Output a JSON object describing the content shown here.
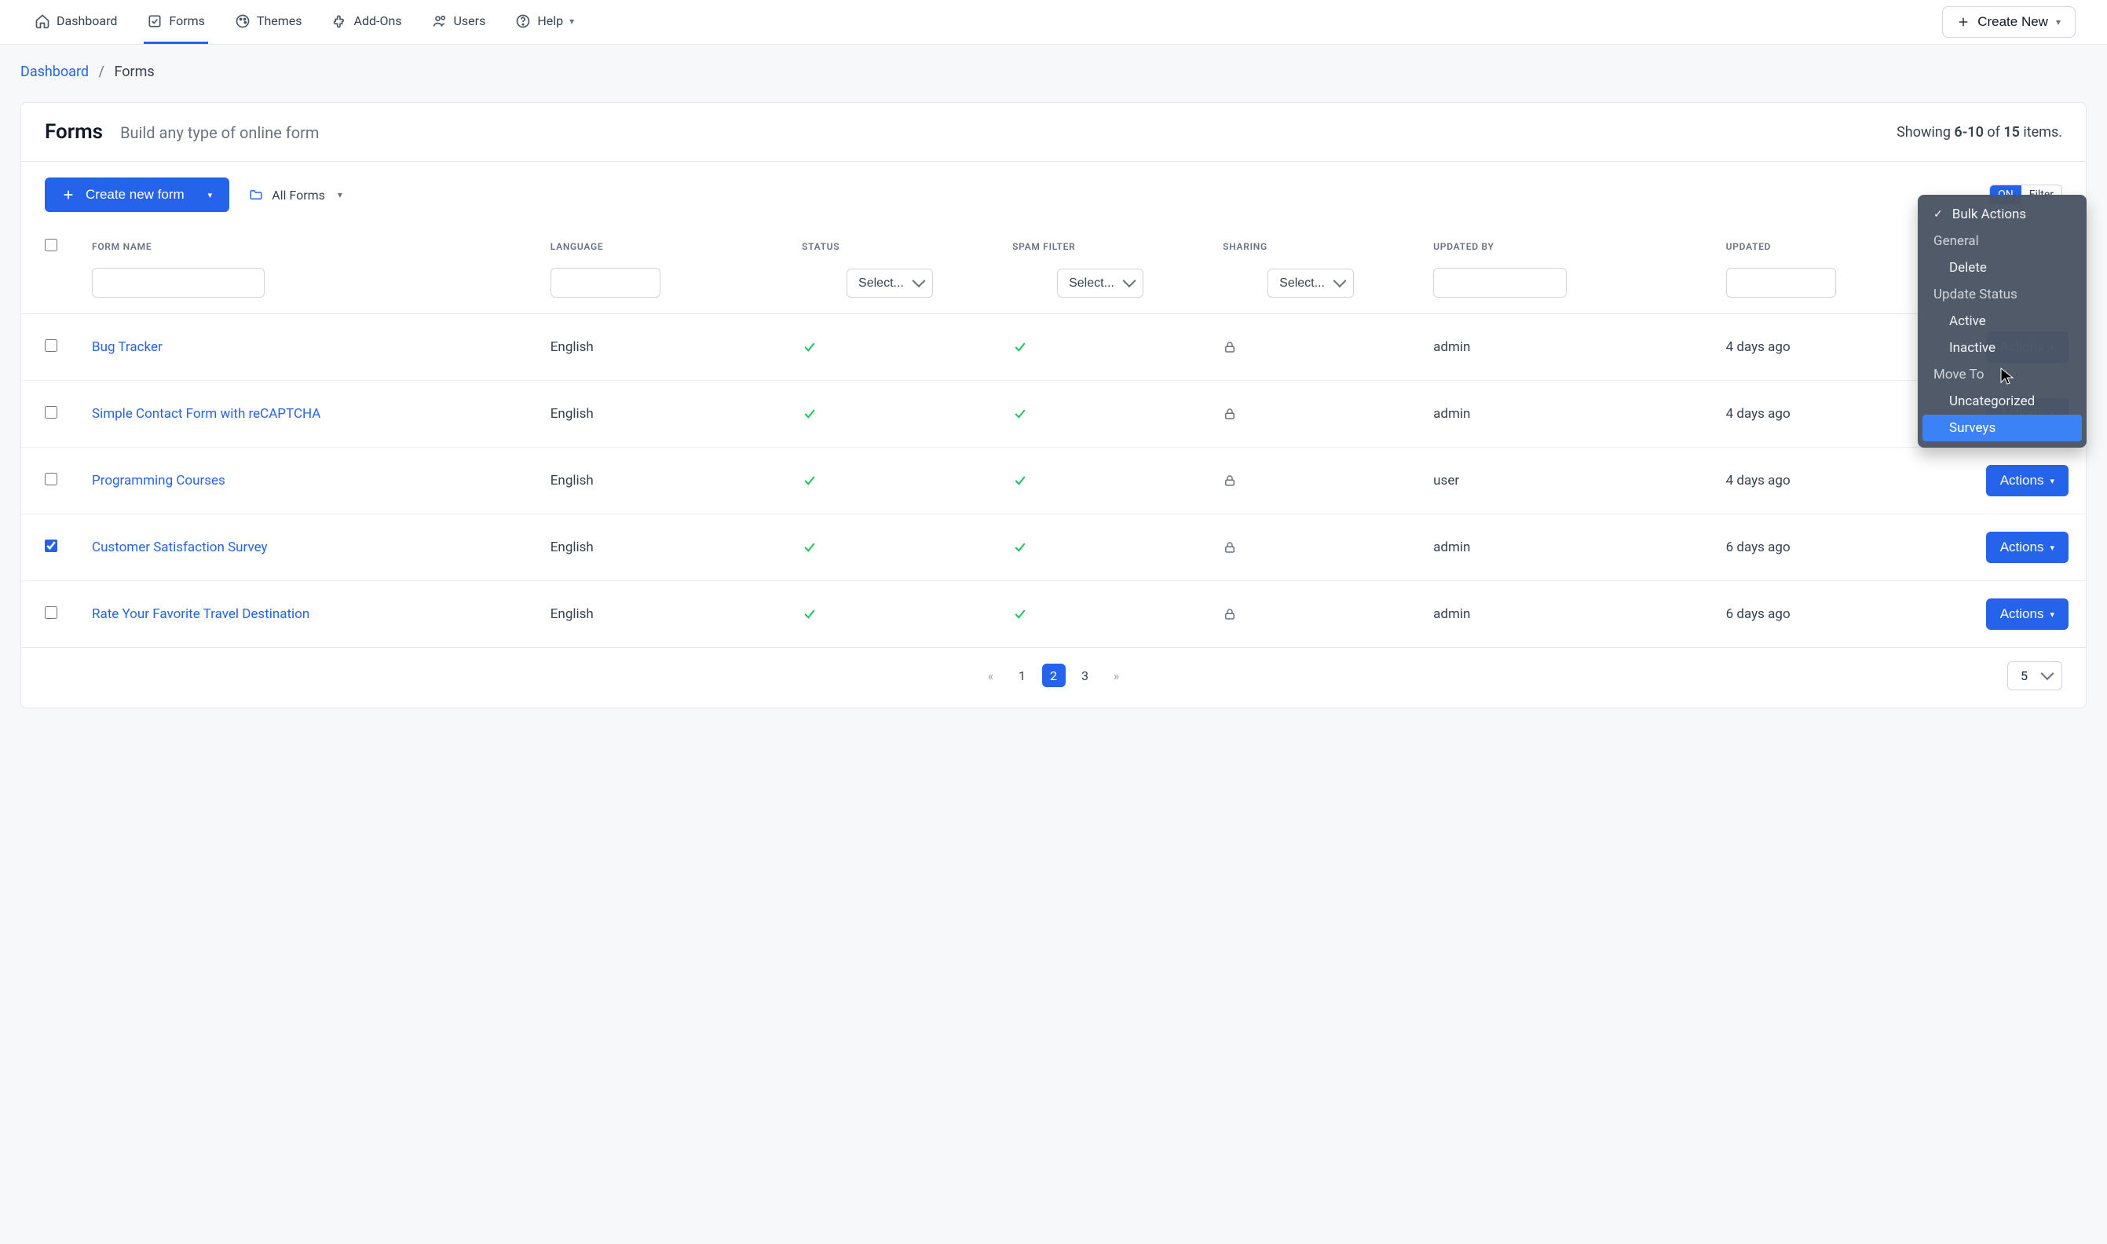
{
  "nav": {
    "items": [
      {
        "label": "Dashboard",
        "icon": "home-icon"
      },
      {
        "label": "Forms",
        "icon": "checkbox-icon",
        "active": true
      },
      {
        "label": "Themes",
        "icon": "palette-icon"
      },
      {
        "label": "Add-Ons",
        "icon": "puzzle-icon"
      },
      {
        "label": "Users",
        "icon": "people-icon"
      },
      {
        "label": "Help",
        "icon": "help-icon",
        "chevron": true
      }
    ],
    "create_new": "Create New"
  },
  "breadcrumb": {
    "root": "Dashboard",
    "current": "Forms"
  },
  "header": {
    "title": "Forms",
    "subtitle": "Build any type of online form",
    "showing_prefix": "Showing ",
    "range": "6-10",
    "of": " of ",
    "total": "15",
    "suffix": " items."
  },
  "toolbar": {
    "create": "Create new form",
    "folder": "All Forms",
    "on": "ON",
    "filter": "Filter"
  },
  "table": {
    "headers": [
      "FORM NAME",
      "LANGUAGE",
      "STATUS",
      "SPAM FILTER",
      "SHARING",
      "UPDATED BY",
      "UPDATED"
    ],
    "select_placeholder": "Select...",
    "actions_label": "Actions",
    "rows": [
      {
        "name": "Bug Tracker",
        "language": "English",
        "updated_by": "admin",
        "updated": "4 days ago",
        "checked": false
      },
      {
        "name": "Simple Contact Form with reCAPTCHA",
        "language": "English",
        "updated_by": "admin",
        "updated": "4 days ago",
        "checked": false
      },
      {
        "name": "Programming Courses",
        "language": "English",
        "updated_by": "user",
        "updated": "4 days ago",
        "checked": false
      },
      {
        "name": "Customer Satisfaction Survey",
        "language": "English",
        "updated_by": "admin",
        "updated": "6 days ago",
        "checked": true
      },
      {
        "name": "Rate Your Favorite Travel Destination",
        "language": "English",
        "updated_by": "admin",
        "updated": "6 days ago",
        "checked": false
      }
    ]
  },
  "pagination": {
    "pages": [
      "1",
      "2",
      "3"
    ],
    "active": "2",
    "page_size": "5"
  },
  "bulk_menu": {
    "title": "Bulk Actions",
    "groups": [
      {
        "label": "General",
        "items": [
          "Delete"
        ]
      },
      {
        "label": "Update Status",
        "items": [
          "Active",
          "Inactive"
        ]
      },
      {
        "label": "Move To",
        "items": [
          "Uncategorized",
          "Surveys"
        ]
      }
    ],
    "highlighted": "Surveys"
  }
}
